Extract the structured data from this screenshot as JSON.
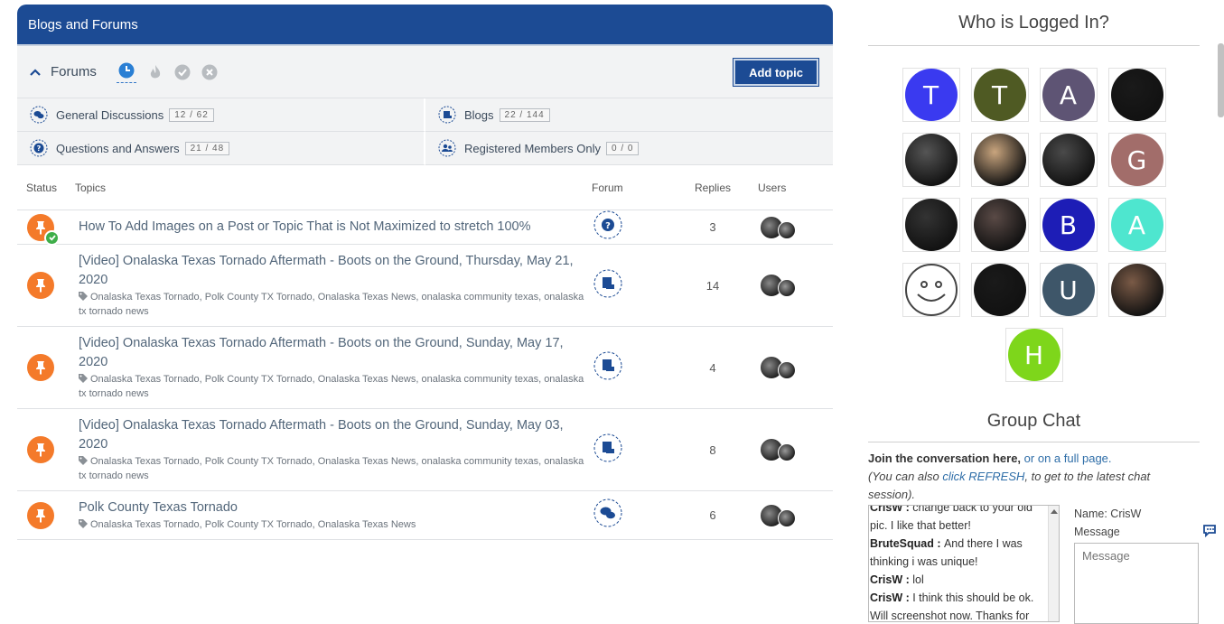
{
  "panel": {
    "title": "Blogs and Forums",
    "forums_label": "Forums",
    "add_topic_label": "Add topic",
    "categories": [
      {
        "label": "General Discussions",
        "count": "12 / 62"
      },
      {
        "label": "Blogs",
        "count": "22 / 144"
      },
      {
        "label": "Questions and Answers",
        "count": "21 / 48"
      },
      {
        "label": "Registered Members Only",
        "count": "0 / 0"
      }
    ],
    "columns": {
      "status": "Status",
      "topics": "Topics",
      "forum": "Forum",
      "replies": "Replies",
      "users": "Users"
    },
    "topics": [
      {
        "title": "How To Add Images on a Post or Topic That is Not Maximized to stretch 100%",
        "tags": "",
        "replies": "3",
        "forum_icon": "question-icon",
        "solved": true
      },
      {
        "title": "[Video] Onalaska Texas Tornado Aftermath - Boots on the Ground, Thursday, May 21, 2020",
        "tags": "Onalaska Texas Tornado, Polk County TX Tornado, Onalaska Texas News, onalaska community texas, onalaska tx tornado news",
        "replies": "14",
        "forum_icon": "blog-icon",
        "solved": false
      },
      {
        "title": "[Video] Onalaska Texas Tornado Aftermath - Boots on the Ground, Sunday, May 17, 2020",
        "tags": "Onalaska Texas Tornado, Polk County TX Tornado, Onalaska Texas News, onalaska community texas, onalaska tx tornado news",
        "replies": "4",
        "forum_icon": "blog-icon",
        "solved": false
      },
      {
        "title": "[Video] Onalaska Texas Tornado Aftermath - Boots on the Ground, Sunday, May 03, 2020",
        "tags": "Onalaska Texas Tornado, Polk County TX Tornado, Onalaska Texas News, onalaska community texas, onalaska tx tornado news",
        "replies": "8",
        "forum_icon": "blog-icon",
        "solved": false
      },
      {
        "title": "Polk County Texas Tornado",
        "tags": "Onalaska Texas Tornado, Polk County TX Tornado, Onalaska Texas News",
        "replies": "6",
        "forum_icon": "discussion-icon",
        "solved": false
      }
    ]
  },
  "sidebar": {
    "logged_in_title": "Who is Logged In?",
    "avatars": [
      {
        "letter": "T",
        "color": "#3a3af0"
      },
      {
        "letter": "T",
        "color": "#4f5a23"
      },
      {
        "letter": "A",
        "color": "#5e5474"
      },
      {
        "letter": "",
        "color": "#1a1a1a"
      },
      {
        "letter": "",
        "color": "#555555"
      },
      {
        "letter": "",
        "color": "#c9a57e"
      },
      {
        "letter": "",
        "color": "#4a4a4a"
      },
      {
        "letter": "G",
        "color": "#a26d6a"
      },
      {
        "letter": "",
        "color": "#333333"
      },
      {
        "letter": "",
        "color": "#5a4a46"
      },
      {
        "letter": "B",
        "color": "#1d1db6"
      },
      {
        "letter": "A",
        "color": "#4ee6cf"
      },
      {
        "letter": "",
        "color": "#ffffff"
      },
      {
        "letter": "",
        "color": "#1a1a1a"
      },
      {
        "letter": "U",
        "color": "#3e5669"
      },
      {
        "letter": "",
        "color": "#7a5a46"
      },
      {
        "letter": "H",
        "color": "#7ed61b"
      }
    ],
    "chat_title": "Group Chat",
    "chat_intro_bold": "Join the conversation here,",
    "chat_intro_link": "or on a full page.",
    "chat_note_1": "(You can also ",
    "chat_note_link": "click REFRESH",
    "chat_note_2": ", to get to the latest chat session).",
    "messages": [
      {
        "user": "CrisW",
        "text": "change back to your old pic. I like that better!"
      },
      {
        "user": "BruteSquad",
        "text": "And there I was thinking i was unique!"
      },
      {
        "user": "CrisW",
        "text": "lol"
      },
      {
        "user": "CrisW",
        "text": "I think this should be ok. Will screenshot now. Thanks for"
      }
    ],
    "name_label": "Name: CrisW",
    "message_label": "Message",
    "message_placeholder": "Message"
  }
}
